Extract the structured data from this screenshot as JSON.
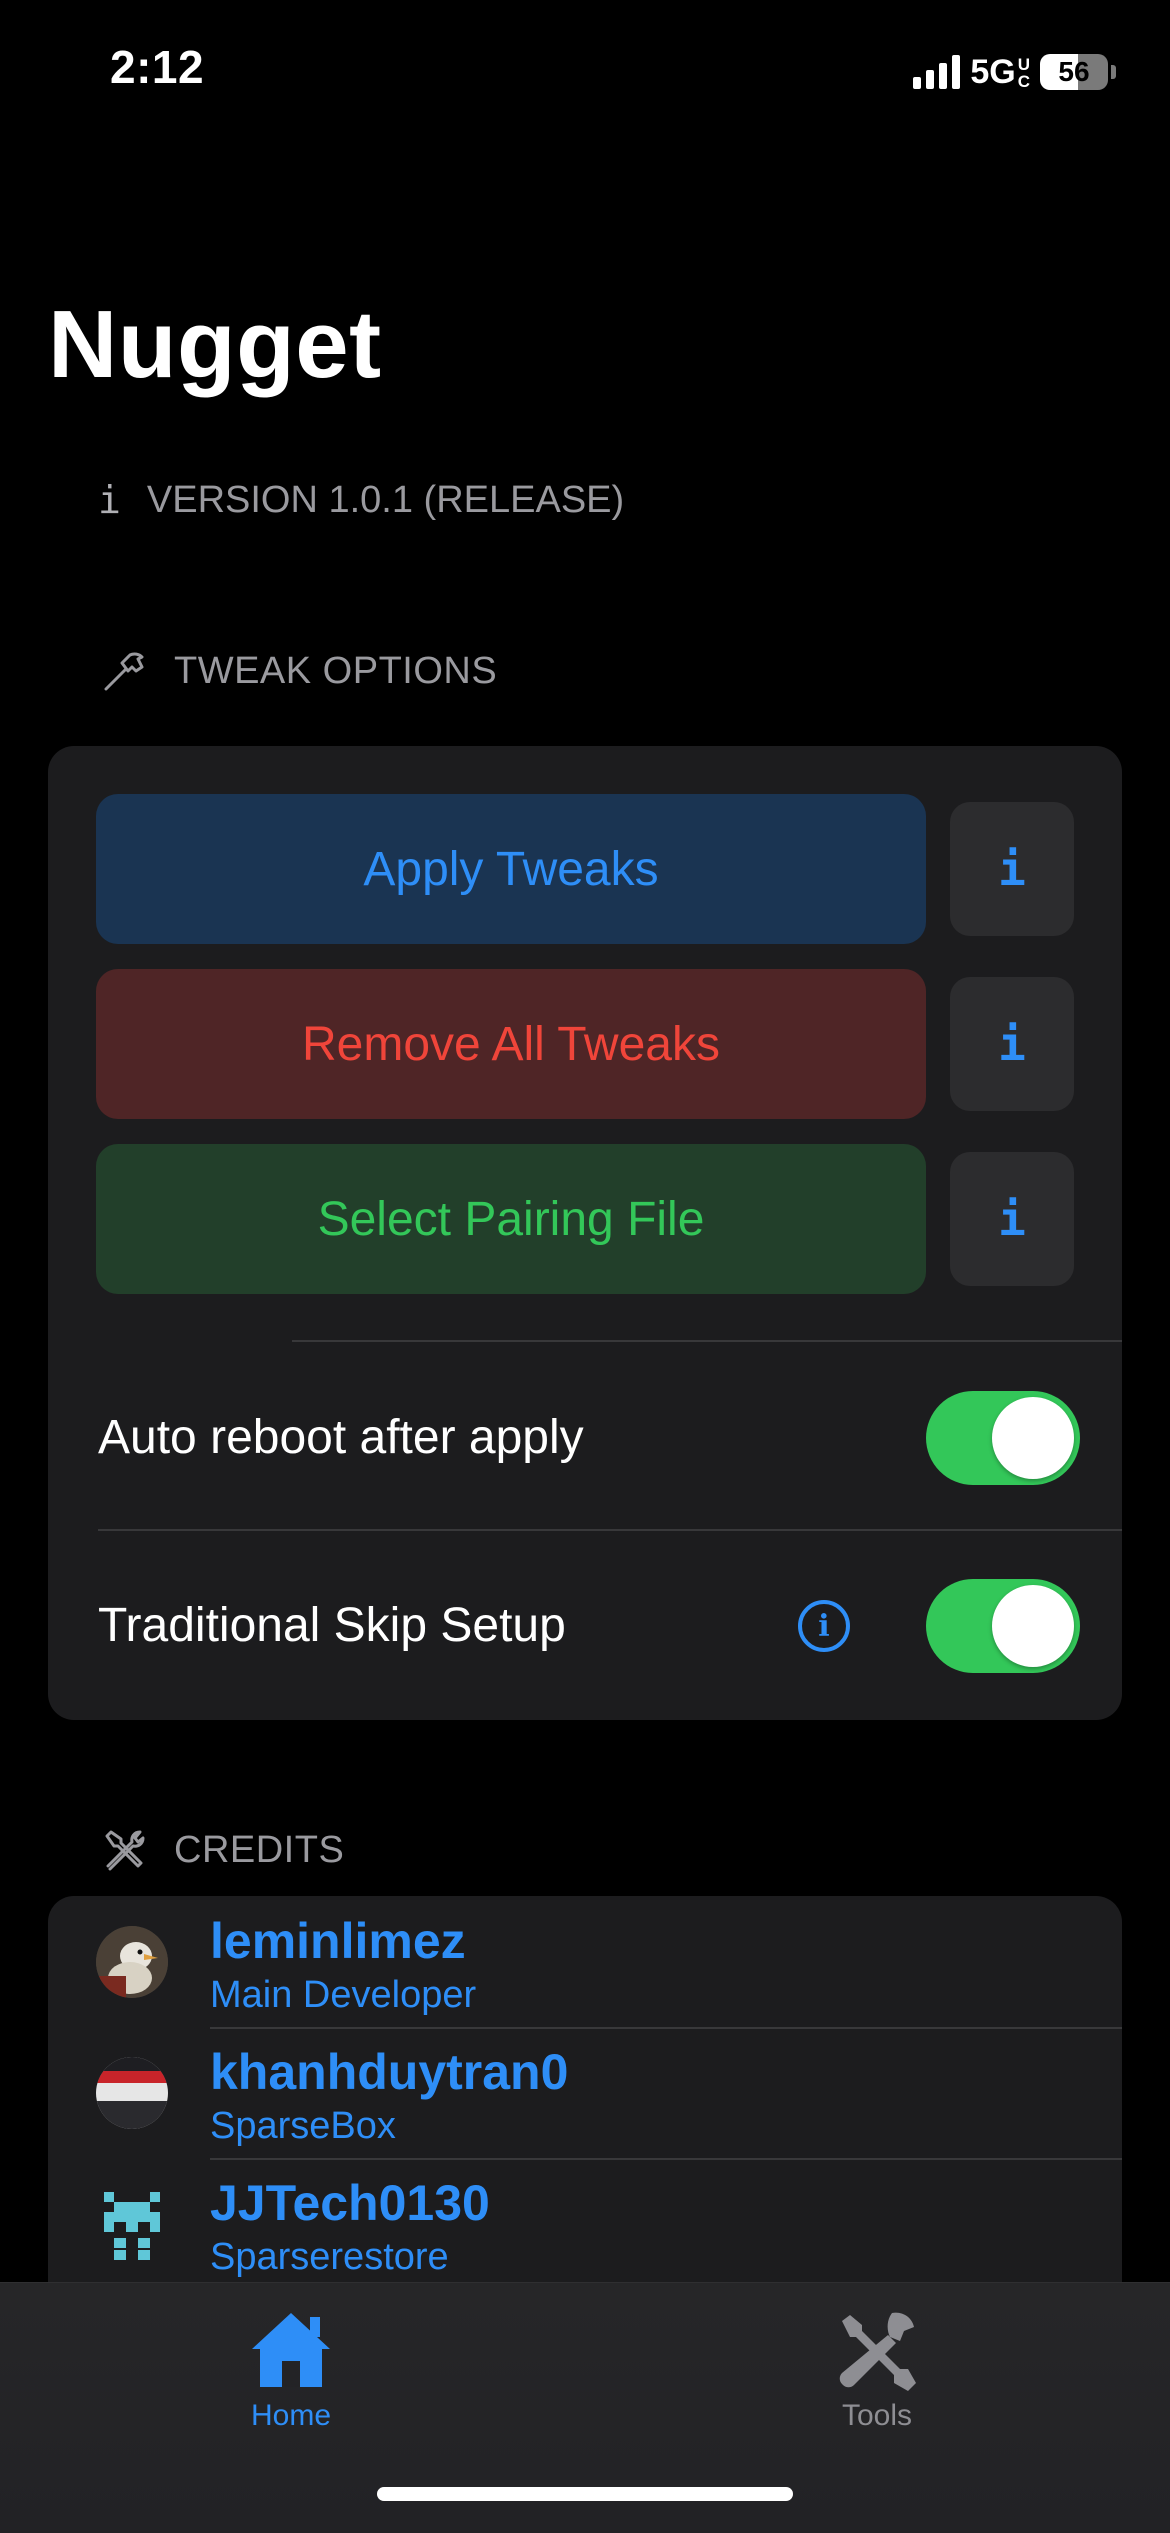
{
  "status_bar": {
    "time": "2:12",
    "network": "5G",
    "network_suffix_top": "U",
    "network_suffix_bottom": "C",
    "battery_level": "56"
  },
  "page": {
    "title": "Nugget",
    "version_icon": "i",
    "version": "VERSION 1.0.1 (RELEASE)"
  },
  "tweak_options": {
    "header": "TWEAK OPTIONS",
    "header_icon": "hammer-icon",
    "buttons": [
      {
        "label": "Apply Tweaks",
        "color": "#2e8ef7",
        "info": "i"
      },
      {
        "label": "Remove All Tweaks",
        "color": "#f0453a",
        "info": "i"
      },
      {
        "label": "Select Pairing File",
        "color": "#33c759",
        "info": "i"
      }
    ],
    "toggles": [
      {
        "label": "Auto reboot after apply",
        "on": true
      },
      {
        "label": "Traditional Skip Setup",
        "on": true,
        "info_icon": "i"
      }
    ]
  },
  "credits": {
    "header": "CREDITS",
    "header_icon": "tools-icon",
    "items": [
      {
        "name": "leminlimez",
        "role": "Main Developer"
      },
      {
        "name": "khanhduytran0",
        "role": "SparseBox"
      },
      {
        "name": "JJTech0130",
        "role": "Sparserestore"
      }
    ]
  },
  "tab_bar": {
    "tabs": [
      {
        "label": "Home",
        "icon": "house-icon",
        "active": true
      },
      {
        "label": "Tools",
        "icon": "wrench-screwdriver-icon",
        "active": false
      }
    ]
  },
  "colors": {
    "accent": "#2e8ef7",
    "destructive": "#f0453a",
    "success": "#33c759",
    "card": "#1c1c1e"
  }
}
